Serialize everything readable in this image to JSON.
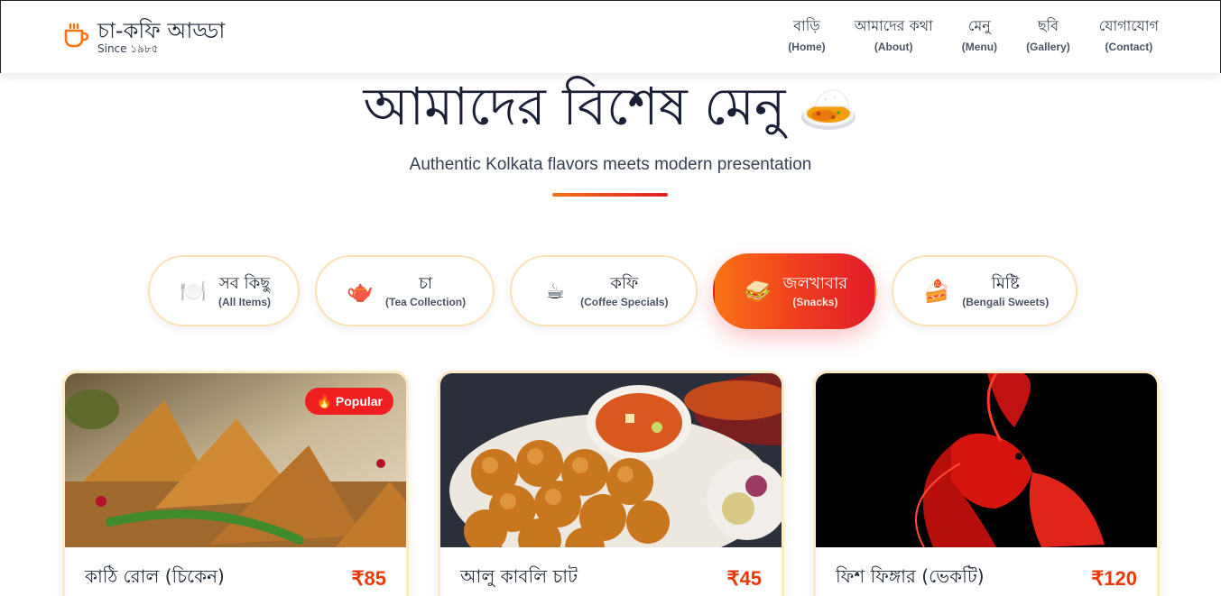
{
  "brand": {
    "name": "চা-কফি আড্ডা",
    "since": "Since ১৯৮৫",
    "icon": "coffee-cup-icon"
  },
  "nav": [
    {
      "bn": "বাড়ি",
      "en": "(Home)"
    },
    {
      "bn": "আমাদের কথা",
      "en": "(About)"
    },
    {
      "bn": "মেনু",
      "en": "(Menu)"
    },
    {
      "bn": "ছবি",
      "en": "(Gallery)"
    },
    {
      "bn": "যোগাযোগ",
      "en": "(Contact)"
    }
  ],
  "hero": {
    "title": "আমাদের বিশেষ মেনু",
    "title_icon": "curry-rice-icon",
    "subtitle": "Authentic Kolkata flavors meets modern presentation"
  },
  "filters": [
    {
      "icon": "🍽️",
      "icon_name": "plate-icon",
      "bn": "সব কিছু",
      "en": "(All Items)",
      "active": false
    },
    {
      "icon": "🫖",
      "icon_name": "teapot-icon",
      "bn": "চা",
      "en": "(Tea Collection)",
      "active": false
    },
    {
      "icon": "☕",
      "icon_name": "coffee-icon",
      "bn": "কফি",
      "en": "(Coffee Specials)",
      "active": false
    },
    {
      "icon": "🥪",
      "icon_name": "sandwich-icon",
      "bn": "জলখাবার",
      "en": "(Snacks)",
      "active": true
    },
    {
      "icon": "🍰",
      "icon_name": "cake-icon",
      "bn": "মিষ্টি",
      "en": "(Bengali Sweets)",
      "active": false
    }
  ],
  "cards": [
    {
      "name": "কাঠি রোল (চিকেন)",
      "price": "₹85",
      "badge": "Popular",
      "badge_icon": "🔥",
      "image": "samosa-photo"
    },
    {
      "name": "আলু কাবলি চাট",
      "price": "₹45",
      "image": "pav-bhaji-photo"
    },
    {
      "name": "ফিশ ফিঙ্গার (ভেকটি)",
      "price": "₹120",
      "image": "red-betta-fish-photo"
    }
  ],
  "colors": {
    "accent_start": "#f97316",
    "accent_end": "#e11d2a",
    "price": "#ea3a0c",
    "pill_border": "#fbe2b5"
  }
}
